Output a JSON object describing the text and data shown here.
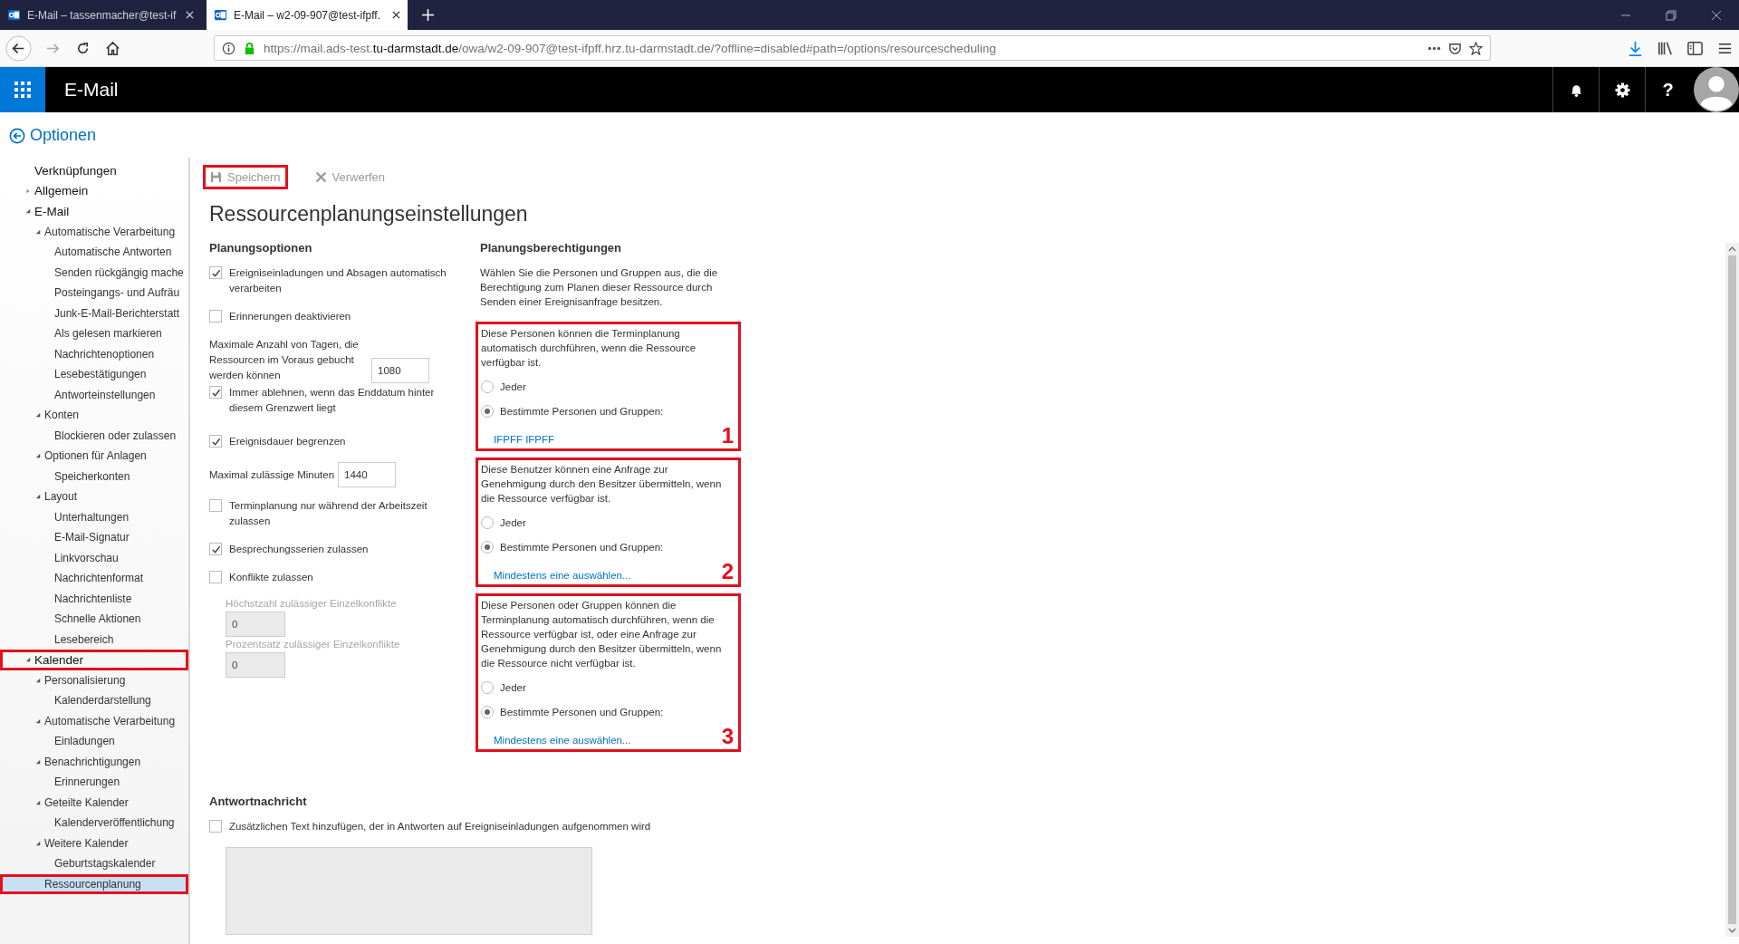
{
  "browser": {
    "tabs": [
      {
        "title": "E-Mail – tassenmacher@test-if",
        "selected": false
      },
      {
        "title": "E-Mail – w2-09-907@test-ifpff.",
        "selected": true
      }
    ],
    "url": {
      "before": "https://mail.ads-test.",
      "domain": "tu-darmstadt.de",
      "after": "/owa/w2-09-907@test-ifpff.hrz.tu-darmstadt.de/?offline=disabled#path=/options/resourcescheduling"
    }
  },
  "app_header": {
    "title": "E-Mail",
    "help_label": "?"
  },
  "back_title": "Optionen",
  "sidebar": {
    "items": [
      {
        "label": "Verknüpfungen",
        "selected": false
      },
      {
        "label": "Allgemein",
        "expanded": false,
        "selected": false
      },
      {
        "label": "E-Mail",
        "expanded": true,
        "selected": false,
        "children": [
          {
            "label": "Automatische Verarbeitung",
            "expanded": true,
            "selected": false,
            "children": [
              {
                "label": "Automatische Antworten",
                "selected": false
              },
              {
                "label": "Senden rückgängig mache",
                "selected": false
              },
              {
                "label": "Posteingangs- und Aufräu",
                "selected": false
              },
              {
                "label": "Junk-E-Mail-Berichterstatt",
                "selected": false
              },
              {
                "label": "Als gelesen markieren",
                "selected": false
              },
              {
                "label": "Nachrichtenoptionen",
                "selected": false
              },
              {
                "label": "Lesebestätigungen",
                "selected": false
              },
              {
                "label": "Antworteinstellungen",
                "selected": false
              }
            ]
          },
          {
            "label": "Konten",
            "expanded": true,
            "selected": false,
            "children": [
              {
                "label": "Blockieren oder zulassen",
                "selected": false
              }
            ]
          },
          {
            "label": "Optionen für Anlagen",
            "expanded": true,
            "selected": false,
            "children": [
              {
                "label": "Speicherkonten",
                "selected": false
              }
            ]
          },
          {
            "label": "Layout",
            "expanded": true,
            "selected": false,
            "children": [
              {
                "label": "Unterhaltungen",
                "selected": false
              },
              {
                "label": "E-Mail-Signatur",
                "selected": false
              },
              {
                "label": "Linkvorschau",
                "selected": false
              },
              {
                "label": "Nachrichtenformat",
                "selected": false
              },
              {
                "label": "Nachrichtenliste",
                "selected": false
              },
              {
                "label": "Schnelle Aktionen",
                "selected": false
              },
              {
                "label": "Lesebereich",
                "selected": false
              }
            ]
          }
        ]
      },
      {
        "label": "Kalender",
        "expanded": true,
        "selected": false,
        "annotated": true,
        "children": [
          {
            "label": "Personalisierung",
            "expanded": true,
            "selected": false,
            "children": [
              {
                "label": "Kalenderdarstellung",
                "selected": false
              }
            ]
          },
          {
            "label": "Automatische Verarbeitung",
            "expanded": true,
            "selected": false,
            "children": [
              {
                "label": "Einladungen",
                "selected": false
              }
            ]
          },
          {
            "label": "Benachrichtigungen",
            "expanded": true,
            "selected": false,
            "children": [
              {
                "label": "Erinnerungen",
                "selected": false
              }
            ]
          },
          {
            "label": "Geteilte Kalender",
            "expanded": true,
            "selected": false,
            "children": [
              {
                "label": "Kalenderveröffentlichung",
                "selected": false
              }
            ]
          },
          {
            "label": "Weitere Kalender",
            "expanded": true,
            "selected": false,
            "children": [
              {
                "label": "Geburtstagskalender",
                "selected": false
              }
            ]
          },
          {
            "label": "Ressourcenplanung",
            "selected": true,
            "annotated": true
          }
        ]
      }
    ]
  },
  "toolbar": {
    "save": {
      "label": "Speichern",
      "disabled": true,
      "annotated": true
    },
    "discard": {
      "label": "Verwerfen",
      "disabled": true
    }
  },
  "page_title": "Ressourcenplanungseinstellungen",
  "options": {
    "heading": "Planungsoptionen",
    "items": [
      {
        "kind": "checkbox",
        "label": "Ereigniseinladungen und Absagen automatisch verarbeiten",
        "checked": true
      },
      {
        "kind": "checkbox",
        "label": "Erinnerungen deaktivieren",
        "checked": false
      },
      {
        "kind": "number",
        "label": "Maximale Anzahl von Tagen, die Ressourcen im Voraus gebucht werden können",
        "value": "1080"
      },
      {
        "kind": "sub_checkbox",
        "label": "Immer ablehnen, wenn das Enddatum hinter diesem Grenzwert liegt",
        "checked": true
      },
      {
        "kind": "checkbox",
        "label": "Ereignisdauer begrenzen",
        "checked": true
      },
      {
        "kind": "sub_number",
        "label": "Maximal zulässige Minuten",
        "value": "1440"
      },
      {
        "kind": "checkbox",
        "label": "Terminplanung nur während der Arbeitszeit zulassen",
        "checked": false
      },
      {
        "kind": "checkbox",
        "label": "Besprechungsserien zulassen",
        "checked": true
      },
      {
        "kind": "checkbox",
        "label": "Konflikte zulassen",
        "checked": false
      },
      {
        "kind": "stacked_field",
        "label": "Höchstzahl zulässiger Einzelkonflikte",
        "value": "0",
        "disabled": true
      },
      {
        "kind": "stacked_field",
        "label": "Prozentsatz zulässiger Einzelkonflikte",
        "value": "0",
        "disabled": true
      }
    ]
  },
  "permissions": {
    "heading": "Planungsberechtigungen",
    "description": "Wählen Sie die Personen und Gruppen aus, die die Berechtigung zum Planen dieser Ressource durch Senden einer Ereignisanfrage besitzen.",
    "groups": [
      {
        "text": "Diese Personen können die Terminplanung automatisch durchführen, wenn die Ressource verfügbar ist.",
        "options": [
          {
            "label": "Jeder",
            "selected": false
          },
          {
            "label": "Bestimmte Personen und Gruppen:",
            "selected": true
          }
        ],
        "link": "IFPFF IFPFF",
        "number": "1",
        "annotated": true
      },
      {
        "text": "Diese Benutzer können eine Anfrage zur Genehmigung durch den Besitzer übermitteln, wenn die Ressource verfügbar ist.",
        "options": [
          {
            "label": "Jeder",
            "selected": false
          },
          {
            "label": "Bestimmte Personen und Gruppen:",
            "selected": true
          }
        ],
        "link": "Mindestens eine auswählen...",
        "number": "2",
        "annotated": true
      },
      {
        "text": "Diese Personen oder Gruppen können die Terminplanung automatisch durchführen, wenn die Ressource verfügbar ist, oder eine Anfrage zur Genehmigung durch den Besitzer übermitteln, wenn die Ressource nicht verfügbar ist.",
        "options": [
          {
            "label": "Jeder",
            "selected": false
          },
          {
            "label": "Bestimmte Personen und Gruppen:",
            "selected": true
          }
        ],
        "link": "Mindestens eine auswählen...",
        "number": "3",
        "annotated": true
      }
    ]
  },
  "reply": {
    "heading": "Antwortnachricht",
    "checkbox": {
      "label": "Zusätzlichen Text hinzufügen, der in Antworten auf Ereigniseinladungen aufgenommen wird",
      "checked": false
    }
  }
}
